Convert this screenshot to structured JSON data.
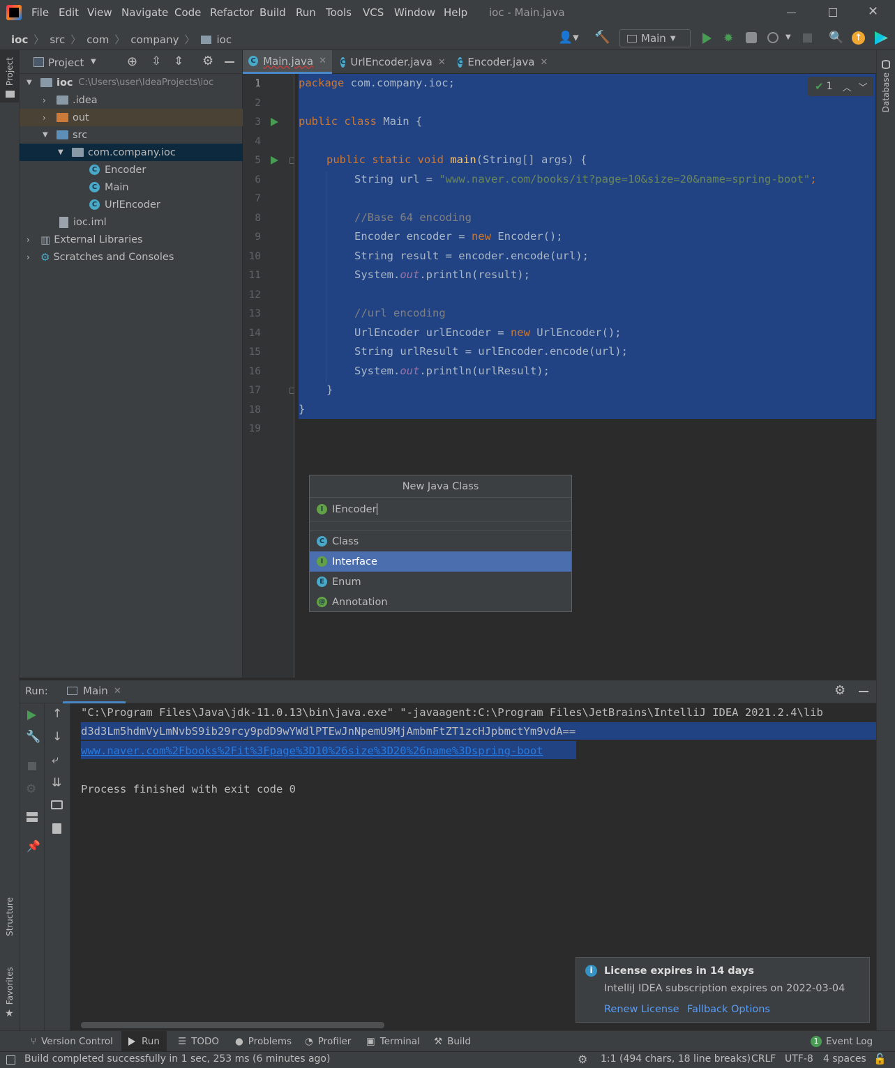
{
  "window": {
    "title": "ioc - Main.java",
    "menu": [
      "File",
      "Edit",
      "View",
      "Navigate",
      "Code",
      "Refactor",
      "Build",
      "Run",
      "Tools",
      "VCS",
      "Window",
      "Help"
    ]
  },
  "breadcrumb": [
    "ioc",
    "src",
    "com",
    "company",
    "ioc"
  ],
  "run_config": "Main",
  "left_strip": {
    "project": "Project",
    "structure": "Structure",
    "favorites": "Favorites"
  },
  "right_strip": {
    "database": "Database"
  },
  "project_panel": {
    "title": "Project",
    "tree": [
      {
        "label": "ioc",
        "extra": "C:\\Users\\user\\IdeaProjects\\ioc"
      },
      {
        "label": ".idea"
      },
      {
        "label": "out"
      },
      {
        "label": "src"
      },
      {
        "label": "com.company.ioc"
      },
      {
        "label": "Encoder"
      },
      {
        "label": "Main"
      },
      {
        "label": "UrlEncoder"
      },
      {
        "label": "ioc.iml"
      },
      {
        "label": "External Libraries"
      },
      {
        "label": "Scratches and Consoles"
      }
    ]
  },
  "editor": {
    "tabs": [
      "Main.java",
      "UrlEncoder.java",
      "Encoder.java"
    ],
    "inspection_count": "1",
    "line_numbers": [
      "1",
      "2",
      "3",
      "4",
      "5",
      "6",
      "7",
      "8",
      "9",
      "10",
      "11",
      "12",
      "13",
      "14",
      "15",
      "16",
      "17",
      "18",
      "19"
    ],
    "code": {
      "l1a": "package",
      "l1b": " com.company.ioc;",
      "l3a": "public class",
      "l3b": " Main {",
      "l5a": "public static void",
      "l5b": "main",
      "l5c": "(String[] args) {",
      "l6a": "String url = ",
      "l6b": "\"www.naver.com/books/it?page=10&size=20&name=spring-boot\"",
      "l6c": ";",
      "l8": "//Base 64 encoding",
      "l9a": "Encoder encoder = ",
      "l9b": "new",
      "l9c": " Encoder();",
      "l10": "String result = encoder.encode(url);",
      "l11a": "System.",
      "l11b": "out",
      "l11c": ".println(result);",
      "l13": "//url encoding",
      "l14a": "UrlEncoder urlEncoder = ",
      "l14b": "new",
      "l14c": " UrlEncoder();",
      "l15": "String urlResult = urlEncoder.encode(url);",
      "l16a": "System.",
      "l16b": "out",
      "l16c": ".println(urlResult);",
      "l17": "}",
      "l18": "}"
    }
  },
  "new_class_popup": {
    "title": "New Java Class",
    "input_value": "IEncoder",
    "options": [
      {
        "label": "Class",
        "icon": "C"
      },
      {
        "label": "Interface",
        "icon": "I"
      },
      {
        "label": "Enum",
        "icon": "E"
      },
      {
        "label": "Annotation",
        "icon": "@"
      }
    ],
    "selected": "Interface"
  },
  "run_panel": {
    "label": "Run:",
    "tab": "Main",
    "console": [
      "\"C:\\Program Files\\Java\\jdk-11.0.13\\bin\\java.exe\" \"-javaagent:C:\\Program Files\\JetBrains\\IntelliJ IDEA 2021.2.4\\lib",
      "d3d3Lm5hdmVyLmNvbS9ib29rcy9pdD9wYWdlPTEwJnNpemU9MjAmbmFtZT1zcHJpbmctYm9vdA==",
      "www.naver.com%2Fbooks%2Fit%3Fpage%3D10%26size%3D20%26name%3Dspring-boot",
      "Process finished with exit code 0"
    ]
  },
  "notification": {
    "title": "License expires in 14 days",
    "body": "IntelliJ IDEA subscription expires on 2022-03-04",
    "action1": "Renew License",
    "action2": "Fallback Options"
  },
  "bottom_tabs": [
    "Version Control",
    "Run",
    "TODO",
    "Problems",
    "Profiler",
    "Terminal",
    "Build"
  ],
  "event_log": {
    "count": "1",
    "label": "Event Log"
  },
  "status": {
    "message": "Build completed successfully in 1 sec, 253 ms (6 minutes ago)",
    "position": "1:1 (494 chars, 18 line breaks)",
    "line_sep": "CRLF",
    "encoding": "UTF-8",
    "indent": "4 spaces"
  },
  "colors": {
    "accent": "#4b6eaf",
    "selection": "#214283",
    "run_green": "#499c54",
    "link": "#287bde"
  }
}
